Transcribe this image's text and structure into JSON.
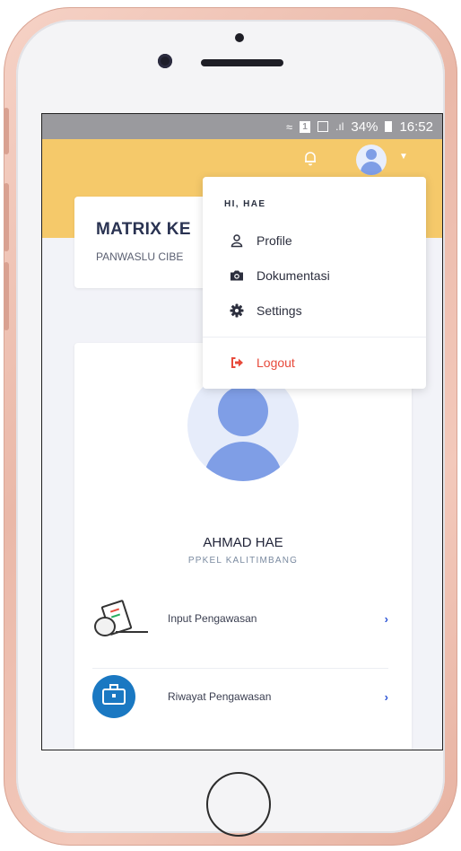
{
  "status_bar": {
    "battery": "34%",
    "time": "16:52",
    "sim": "1"
  },
  "header": {
    "notifications_icon": "bell-icon",
    "avatar_icon": "user-avatar-icon",
    "caret_icon": "caret-down-icon"
  },
  "title_card": {
    "title": "MATRIX KE",
    "subtitle": "PANWASLU CIBE"
  },
  "dropdown": {
    "greeting": "HI, HAE",
    "items": [
      {
        "label": "Profile",
        "icon": "user-icon"
      },
      {
        "label": "Dokumentasi",
        "icon": "camera-icon"
      },
      {
        "label": "Settings",
        "icon": "gear-icon"
      }
    ],
    "logout": {
      "label": "Logout",
      "icon": "sign-out-icon",
      "color": "#e74a3b"
    }
  },
  "profile": {
    "name": "AHMAD HAE",
    "role": "PPKEL KALITIMBANG",
    "menu": [
      {
        "label": "Input Pengawasan",
        "icon": "checklist-hand-icon"
      },
      {
        "label": "Riwayat Pengawasan",
        "icon": "briefcase-icon"
      }
    ]
  },
  "colors": {
    "appbar": "#f5c96a",
    "accent": "#2d55d6",
    "avatar": "#7f9ee6"
  }
}
